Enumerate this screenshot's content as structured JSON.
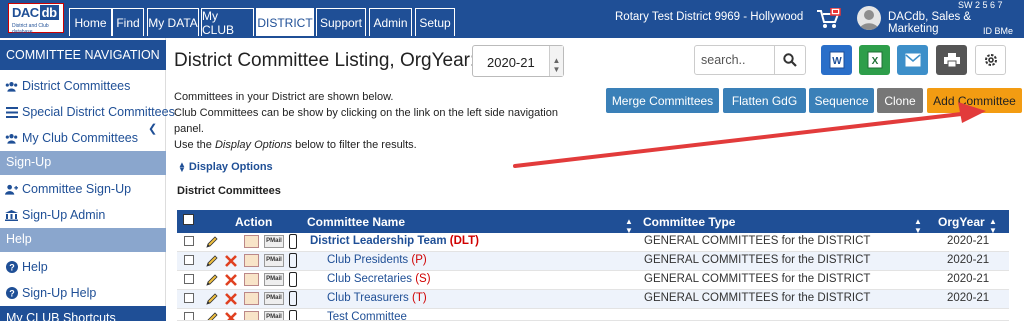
{
  "logo": {
    "line1a": "DAC",
    "line1b": "db",
    "line2": "District and Club database"
  },
  "nav": {
    "tabs": [
      "Home",
      "Find",
      "My DATA",
      "My CLUB",
      "DISTRICT",
      "Support",
      "Admin",
      "Setup"
    ],
    "active": "DISTRICT"
  },
  "header": {
    "district": "Rotary Test District 9969 - Hollywood",
    "user": "DACdb, Sales & Marketing",
    "ids_top": "SW  2  5  6  7",
    "ids_bottom": "ID   BMe"
  },
  "sidebar": {
    "nav_title": "COMMITTEE NAVIGATION",
    "nav_items": [
      "District Committees",
      "Special District Committees",
      "My Club Committees"
    ],
    "signup_title": "Sign-Up",
    "signup_items": [
      "Committee Sign-Up",
      "Sign-Up Admin"
    ],
    "help_title": "Help",
    "help_items": [
      "Help",
      "Sign-Up Help"
    ],
    "shortcuts_title": "My CLUB Shortcuts"
  },
  "main": {
    "title": "District Committee Listing, OrgYear:",
    "year": "2020-21",
    "search_placeholder": "search..",
    "intro1": "Committees in your District are shown below.",
    "intro2": "Club Committees can be show by clicking on the link on the left side navigation panel.",
    "intro3a": "Use the ",
    "intro3b": "Display Options",
    "intro3c": " below to filter the results.",
    "buttons": [
      "Merge Committees",
      "Flatten GdG",
      "Sequence",
      "Clone",
      "Add Committee"
    ],
    "display_options": "Display Options",
    "section": "District Committees"
  },
  "table": {
    "headers": [
      "Action",
      "Committee Name",
      "Committee Type",
      "OrgYear"
    ],
    "pmail": "PMail",
    "rows": [
      {
        "name": "District Leadership Team",
        "abbr": "(DLT)",
        "type": "GENERAL COMMITTEES for the DISTRICT",
        "year": "2020-21"
      },
      {
        "name": "Club Presidents",
        "abbr": "(P)",
        "type": "GENERAL COMMITTEES for the DISTRICT",
        "year": "2020-21"
      },
      {
        "name": "Club Secretaries",
        "abbr": "(S)",
        "type": "GENERAL COMMITTEES for the DISTRICT",
        "year": "2020-21"
      },
      {
        "name": "Club Treasurers",
        "abbr": "(T)",
        "type": "GENERAL COMMITTEES for the DISTRICT",
        "year": "2020-21"
      },
      {
        "name": "Test Committee",
        "abbr": "",
        "type": "",
        "year": ""
      }
    ]
  },
  "colors": {
    "brand": "#1f4f96",
    "add": "#f39c12",
    "action": "#3a80b8",
    "clone": "#777777",
    "arrow": "#e23b3b"
  }
}
